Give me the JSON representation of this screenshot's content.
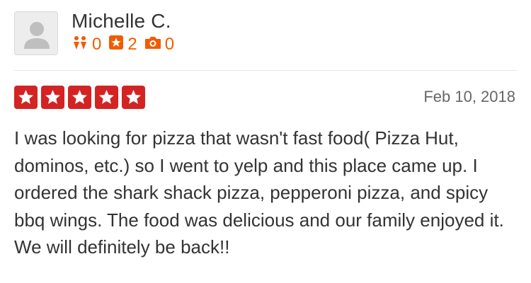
{
  "user": {
    "name": "Michelle C.",
    "avatar_icon": "default-user-avatar-icon",
    "stats": {
      "friends": "0",
      "friends_icon": "friends-icon",
      "reviews": "2",
      "reviews_icon": "star-review-icon",
      "photos": "0",
      "photos_icon": "camera-icon"
    }
  },
  "review": {
    "rating": 5,
    "rating_max": 5,
    "date": "Feb 10, 2018",
    "text": "I was looking for pizza that wasn't fast food( Pizza Hut, dominos, etc.) so I went to yelp and this place came up. I ordered the shark shack pizza, pepperoni pizza, and spicy bbq wings. The food was delicious and our family enjoyed it. We will definitely be back!!"
  },
  "colors": {
    "star_fill": "#d32323",
    "stat_accent": "#f15c00",
    "text": "#333333",
    "muted": "#666666"
  }
}
